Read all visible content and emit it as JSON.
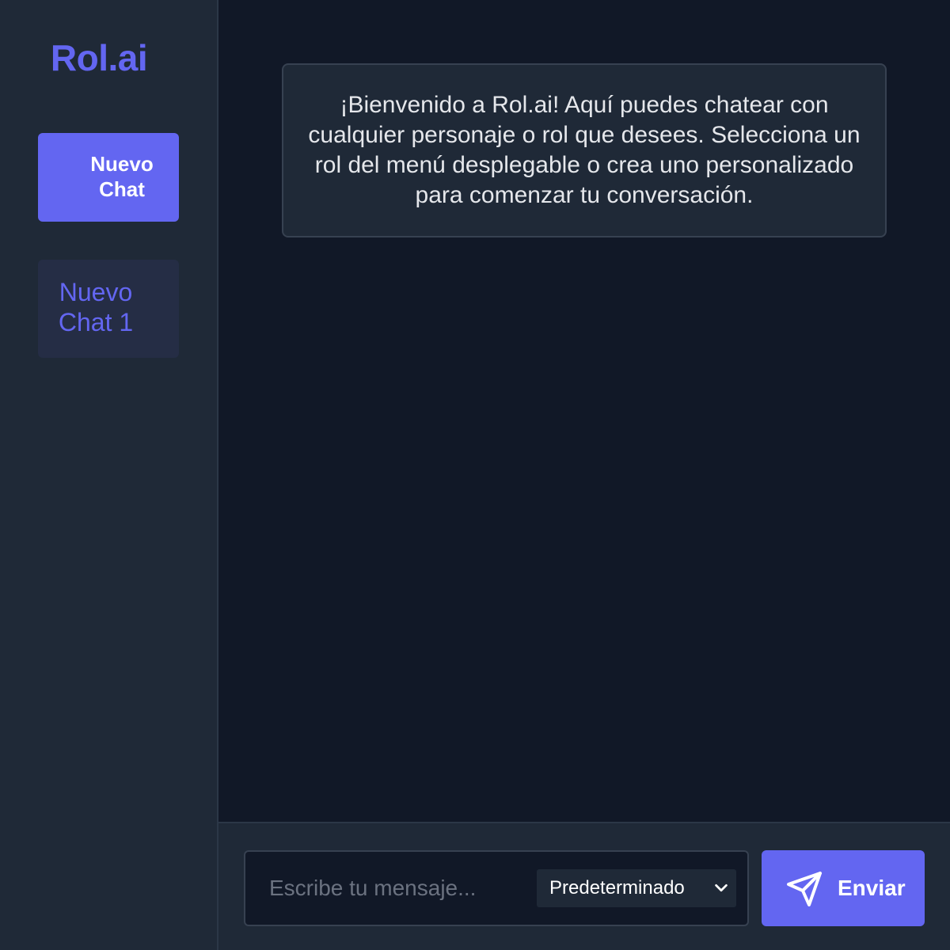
{
  "sidebar": {
    "logo": "Rol.ai",
    "new_chat_label": "Nuevo Chat",
    "chats": [
      {
        "label": "Nuevo Chat 1"
      }
    ]
  },
  "main": {
    "welcome_message": "¡Bienvenido a Rol.ai! Aquí puedes chatear con cualquier personaje o rol que desees. Selecciona un rol del menú desplegable o crea uno personalizado para comenzar tu conversación."
  },
  "composer": {
    "placeholder": "Escribe tu mensaje...",
    "value": "",
    "role_selected": "Predeterminado",
    "send_label": "Enviar",
    "send_icon": "paper-plane-icon",
    "dropdown_icon": "chevron-down-icon"
  },
  "colors": {
    "accent": "#6366f1",
    "sidebar_bg": "#1f2937",
    "main_bg": "#111827",
    "card_bg": "#1f2937",
    "text": "#e5e7eb"
  }
}
